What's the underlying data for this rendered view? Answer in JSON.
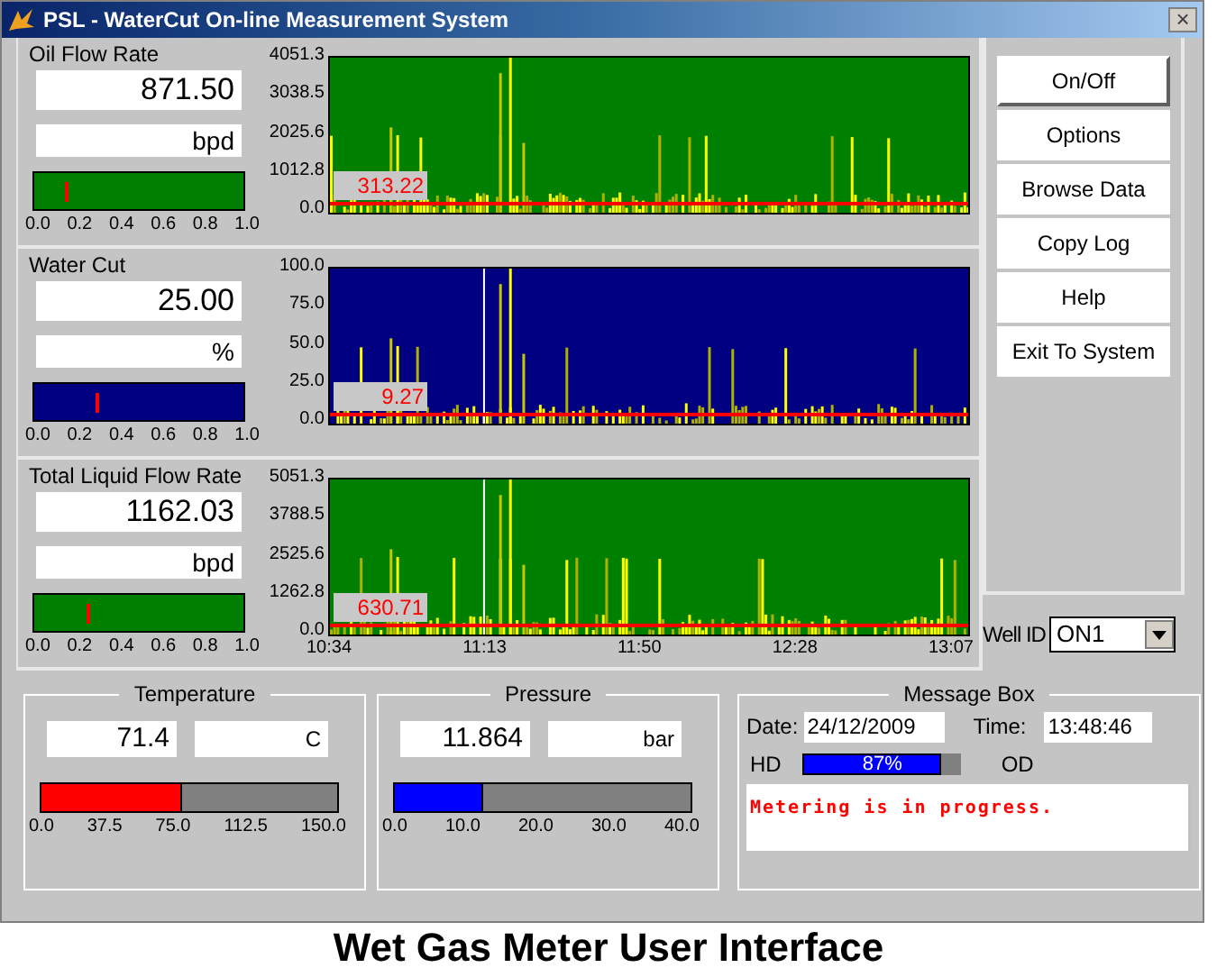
{
  "window": {
    "title": "PSL - WaterCut On-line Measurement System",
    "close": "×"
  },
  "sections": [
    {
      "label": "Oil Flow Rate",
      "value": "871.50",
      "unit": "bpd",
      "color": "#008000",
      "gauge": {
        "level": 0.15,
        "ticks": [
          "0.0",
          "0.2",
          "0.4",
          "0.6",
          "0.8",
          "1.0"
        ]
      },
      "chart": {
        "yticks": [
          "4051.3",
          "3038.5",
          "2025.6",
          "1012.8",
          "0.0"
        ],
        "mean": {
          "label": "313.22"
        },
        "cursor": false
      }
    },
    {
      "label": "Water Cut",
      "value": "25.00",
      "unit": "%",
      "color": "#000080",
      "gauge": {
        "level": 0.29,
        "ticks": [
          "0.0",
          "0.2",
          "0.4",
          "0.6",
          "0.8",
          "1.0"
        ]
      },
      "chart": {
        "yticks": [
          "100.0",
          "75.0",
          "50.0",
          "25.0",
          "0.0"
        ],
        "mean": {
          "label": "9.27"
        },
        "cursor": true
      }
    },
    {
      "label": "Total Liquid Flow Rate",
      "value": "1162.03",
      "unit": "bpd",
      "color": "#008000",
      "gauge": {
        "level": 0.25,
        "ticks": [
          "0.0",
          "0.2",
          "0.4",
          "0.6",
          "0.8",
          "1.0"
        ]
      },
      "chart": {
        "yticks": [
          "5051.3",
          "3788.5",
          "2525.6",
          "1262.8",
          "0.0"
        ],
        "mean": {
          "label": "630.71"
        },
        "cursor": true,
        "xticks": [
          "10:34",
          "11:13",
          "11:50",
          "12:28",
          "13:07"
        ]
      }
    }
  ],
  "buttons": [
    {
      "label": "On/Off",
      "default": true
    },
    {
      "label": "Options",
      "default": false
    },
    {
      "label": "Browse Data",
      "default": false
    },
    {
      "label": "Copy Log",
      "default": false
    },
    {
      "label": "Help",
      "default": false
    },
    {
      "label": "Exit To System",
      "default": false
    }
  ],
  "well_id": {
    "label": "Well ID",
    "value": "ON1"
  },
  "gauges": [
    {
      "title": "Temperature",
      "value": "71.4",
      "unit": "C",
      "level": 0.476,
      "color": "#ff0000",
      "ticks": [
        "0.0",
        "37.5",
        "75.0",
        "112.5",
        "150.0"
      ]
    },
    {
      "title": "Pressure",
      "value": "11.864",
      "unit": "bar",
      "level": 0.297,
      "color": "#0000ff",
      "ticks": [
        "0.0",
        "10.0",
        "20.0",
        "30.0",
        "40.0"
      ]
    }
  ],
  "message_box": {
    "title": "Message Box",
    "date_label": "Date:",
    "date": "24/12/2009",
    "time_label": "Time:",
    "time": "13:48:46",
    "left_label": "HD",
    "right_label": "OD",
    "progress": {
      "level": 0.87,
      "label": "87%"
    },
    "message": "Metering is in progress."
  },
  "caption": "Wet Gas Meter User Interface"
}
